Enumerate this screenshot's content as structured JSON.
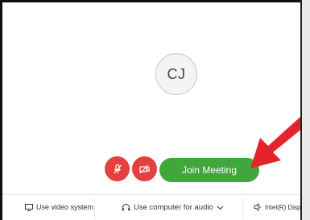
{
  "avatar": {
    "initials": "CJ"
  },
  "controls": {
    "mute_icon": "microphone-muted-icon",
    "video_icon": "video-off-icon",
    "join_label": "Join Meeting"
  },
  "annotation": {
    "arrow_color": "#e3242b",
    "icon": "red-arrow-icon"
  },
  "bottom_bar": {
    "video_system": "Use video system",
    "audio": "Use computer for audio",
    "device": "Intel(R) Display Aud"
  },
  "colors": {
    "join_green": "#3fa73b",
    "control_red": "#e5403f"
  }
}
